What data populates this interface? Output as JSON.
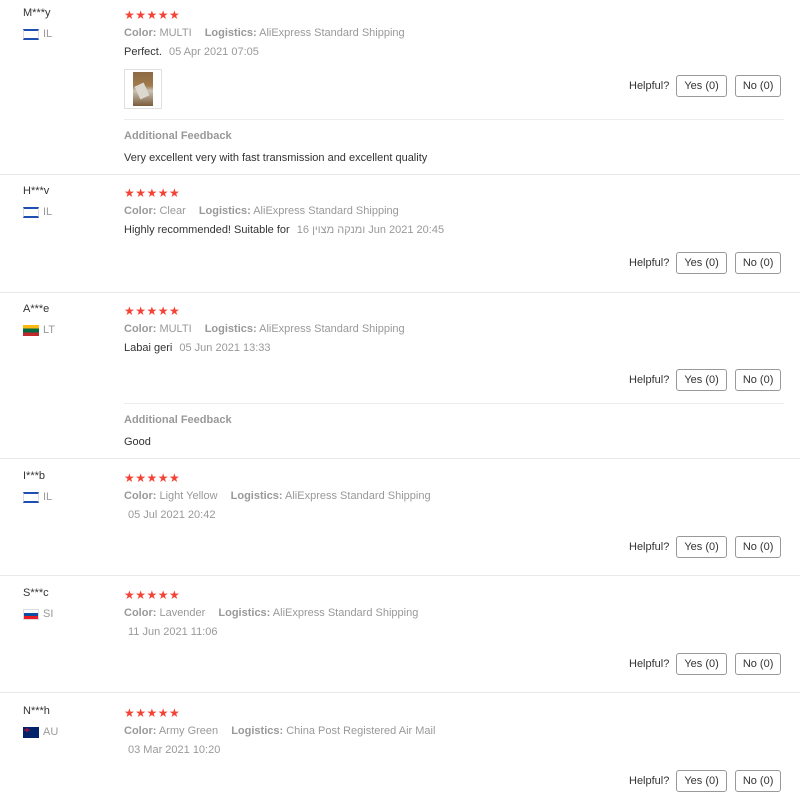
{
  "helpful_label": "Helpful?",
  "flags": {
    "IL": "flag-israel-icon",
    "LT": "flag-lithuania-icon",
    "SI": "flag-slovenia-icon",
    "AU": "flag-australia-icon"
  },
  "star_color": "#f44336",
  "reviews": [
    {
      "user": "M***y",
      "country": "IL",
      "stars": "★★★★★",
      "rating": 5,
      "color_label": "Color:",
      "color_value": "MULTI",
      "logistics_label": "Logistics:",
      "logistics_value": "AliExpress Standard Shipping",
      "text": "Perfect.",
      "date": "05 Apr 2021 07:05",
      "has_photo": true,
      "yes_label": "Yes (0)",
      "no_label": "No (0)",
      "feedback_title": "Additional Feedback",
      "feedback_text": "Very excellent very with fast transmission and excellent quality"
    },
    {
      "user": "H***v",
      "country": "IL",
      "stars": "★★★★★",
      "rating": 5,
      "color_label": "Color:",
      "color_value": "Clear",
      "logistics_label": "Logistics:",
      "logistics_value": "AliExpress Standard Shipping",
      "text": "Highly recommended! Suitable for",
      "date": "16 ומנקה מצוין Jun 2021 20:45",
      "yes_label": "Yes (0)",
      "no_label": "No (0)"
    },
    {
      "user": "A***e",
      "country": "LT",
      "stars": "★★★★★",
      "rating": 5,
      "color_label": "Color:",
      "color_value": "MULTI",
      "logistics_label": "Logistics:",
      "logistics_value": "AliExpress Standard Shipping",
      "text": "Labai geri",
      "date": "05 Jun 2021 13:33",
      "yes_label": "Yes (0)",
      "no_label": "No (0)",
      "feedback_title": "Additional Feedback",
      "feedback_text": "Good"
    },
    {
      "user": "I***b",
      "country": "IL",
      "stars": "★★★★★",
      "rating": 5,
      "color_label": "Color:",
      "color_value": "Light Yellow",
      "logistics_label": "Logistics:",
      "logistics_value": "AliExpress Standard Shipping",
      "text": "",
      "date": "05 Jul 2021 20:42",
      "yes_label": "Yes (0)",
      "no_label": "No (0)"
    },
    {
      "user": "S***c",
      "country": "SI",
      "stars": "★★★★★",
      "rating": 5,
      "color_label": "Color:",
      "color_value": "Lavender",
      "logistics_label": "Logistics:",
      "logistics_value": "AliExpress Standard Shipping",
      "text": "",
      "date": "11 Jun 2021 11:06",
      "yes_label": "Yes (0)",
      "no_label": "No (0)"
    },
    {
      "user": "N***h",
      "country": "AU",
      "stars": "★★★★★",
      "rating": 5,
      "color_label": "Color:",
      "color_value": "Army Green",
      "logistics_label": "Logistics:",
      "logistics_value": "China Post Registered Air Mail",
      "text": "",
      "date": "03 Mar 2021 10:20",
      "yes_label": "Yes (0)",
      "no_label": "No (0)"
    }
  ]
}
